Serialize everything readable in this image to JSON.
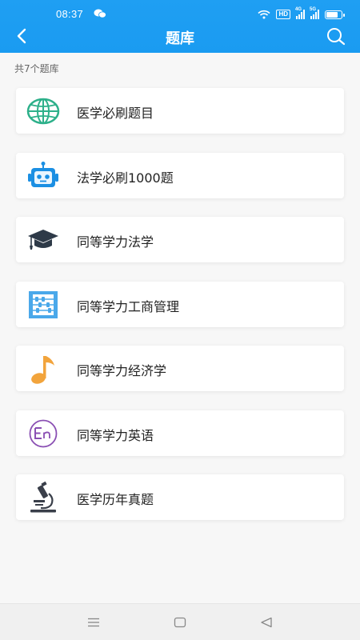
{
  "status_bar": {
    "time": "08:37",
    "hd_badge": "HD",
    "signal_tags": [
      "4G",
      "5G"
    ],
    "battery_level": 0.85,
    "icons": [
      "wechat-icon",
      "wifi-icon",
      "signal-icon",
      "battery-icon"
    ]
  },
  "header": {
    "title": "题库",
    "background_color": "#1a9bf1",
    "back_icon": "chevron-left-icon",
    "search_icon": "search-icon"
  },
  "summary": {
    "count_text": "共7个题库"
  },
  "items": [
    {
      "label": "医学必刷题目",
      "icon": "globe-icon",
      "icon_color": "#2db08a"
    },
    {
      "label": "法学必刷1000题",
      "icon": "robot-icon",
      "icon_color": "#1b8fe3"
    },
    {
      "label": "同等学力法学",
      "icon": "graduation-cap-icon",
      "icon_color": "#2e3a48"
    },
    {
      "label": "同等学力工商管理",
      "icon": "abacus-icon",
      "icon_color": "#4aa8ea"
    },
    {
      "label": "同等学力经济学",
      "icon": "music-note-icon",
      "icon_color": "#f2a43c"
    },
    {
      "label": "同等学力英语",
      "icon": "english-icon",
      "icon_color": "#8a4fb3"
    },
    {
      "label": "医学历年真题",
      "icon": "microscope-icon",
      "icon_color": "#3a3f4a"
    }
  ],
  "nav_bar": {
    "icons": [
      "menu-icon",
      "home-square-icon",
      "back-triangle-icon"
    ]
  }
}
